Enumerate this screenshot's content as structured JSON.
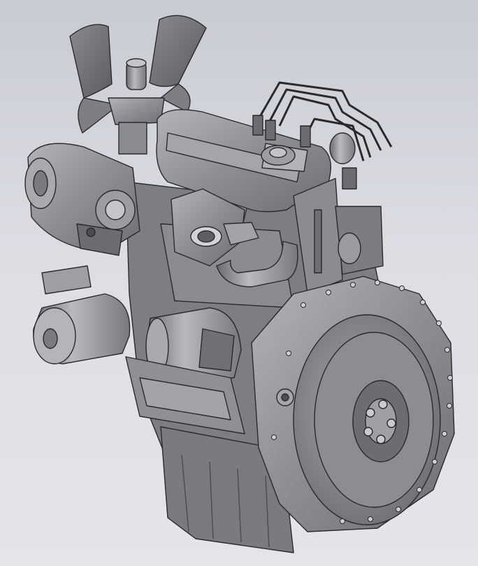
{
  "viewport": {
    "background_top": "#c9cbd2",
    "background_bottom": "#e3e5ea",
    "model_shade": "#8f9094",
    "model_edge": "#2a2a2c"
  },
  "model": {
    "parts": [
      "fan-blades",
      "thermostat-housing",
      "alternator",
      "cylinder-head-cover",
      "fuel-injection-lines",
      "fuel-injector",
      "exhaust-manifold",
      "exhaust-pipe",
      "oil-filter",
      "starter-motor",
      "engine-block",
      "flywheel-housing",
      "flywheel",
      "oil-pan"
    ]
  }
}
